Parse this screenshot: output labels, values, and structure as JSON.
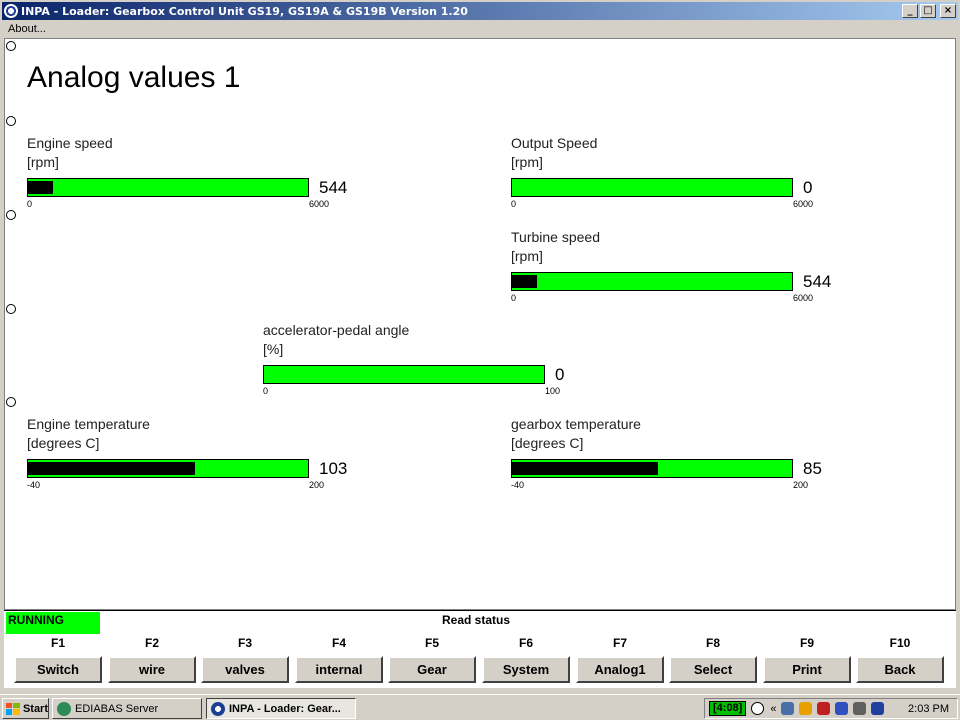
{
  "window": {
    "title": "INPA - Loader:  Gearbox Control Unit GS19, GS19A & GS19B Version 1.20",
    "controls": {
      "minimize": "_",
      "maximize": "□",
      "close": "×"
    }
  },
  "menu": {
    "items": [
      "About..."
    ]
  },
  "page": {
    "title": "Analog values 1"
  },
  "gauges": [
    {
      "id": "engine-speed",
      "label": "Engine speed",
      "unit": "[rpm]",
      "value": "544",
      "min": "0",
      "max": "6000",
      "fraction": 0.0907
    },
    {
      "id": "output-speed",
      "label": "Output Speed",
      "unit": "[rpm]",
      "value": "0",
      "min": "0",
      "max": "6000",
      "fraction": 0
    },
    {
      "id": "turbine-speed",
      "label": "Turbine speed",
      "unit": "[rpm]",
      "value": "544",
      "min": "0",
      "max": "6000",
      "fraction": 0.0907
    },
    {
      "id": "accelerator-pedal-angle",
      "label": "accelerator-pedal angle",
      "unit": "[%]",
      "value": "0",
      "min": "0",
      "max": "100",
      "fraction": 0
    },
    {
      "id": "engine-temperature",
      "label": "Engine temperature",
      "unit": "[degrees C]",
      "value": "103",
      "min": "-40",
      "max": "200",
      "fraction": 0.5958
    },
    {
      "id": "gearbox-temperature",
      "label": "gearbox temperature",
      "unit": "[degrees C]",
      "value": "85",
      "min": "-40",
      "max": "200",
      "fraction": 0.5208
    }
  ],
  "status": {
    "running": "RUNNING",
    "read_status": "Read status"
  },
  "fkeys": [
    {
      "key": "F1",
      "label": "Switch"
    },
    {
      "key": "F2",
      "label": "wire"
    },
    {
      "key": "F3",
      "label": "valves"
    },
    {
      "key": "F4",
      "label": "internal"
    },
    {
      "key": "F5",
      "label": "Gear"
    },
    {
      "key": "F6",
      "label": "System"
    },
    {
      "key": "F7",
      "label": "Analog1"
    },
    {
      "key": "F8",
      "label": "Select"
    },
    {
      "key": "F9",
      "label": "Print"
    },
    {
      "key": "F10",
      "label": "Back"
    }
  ],
  "taskbar": {
    "start": "Start",
    "items": [
      "EDIABAS Server",
      "INPA - Loader:  Gear..."
    ],
    "tray": {
      "timer": "[4:08]",
      "chevron": "«",
      "clock": "2:03 PM"
    }
  },
  "colors": {
    "bar_fill": "#00ff00",
    "running_bg": "#00ff00",
    "title_bar": "#0a246a"
  }
}
